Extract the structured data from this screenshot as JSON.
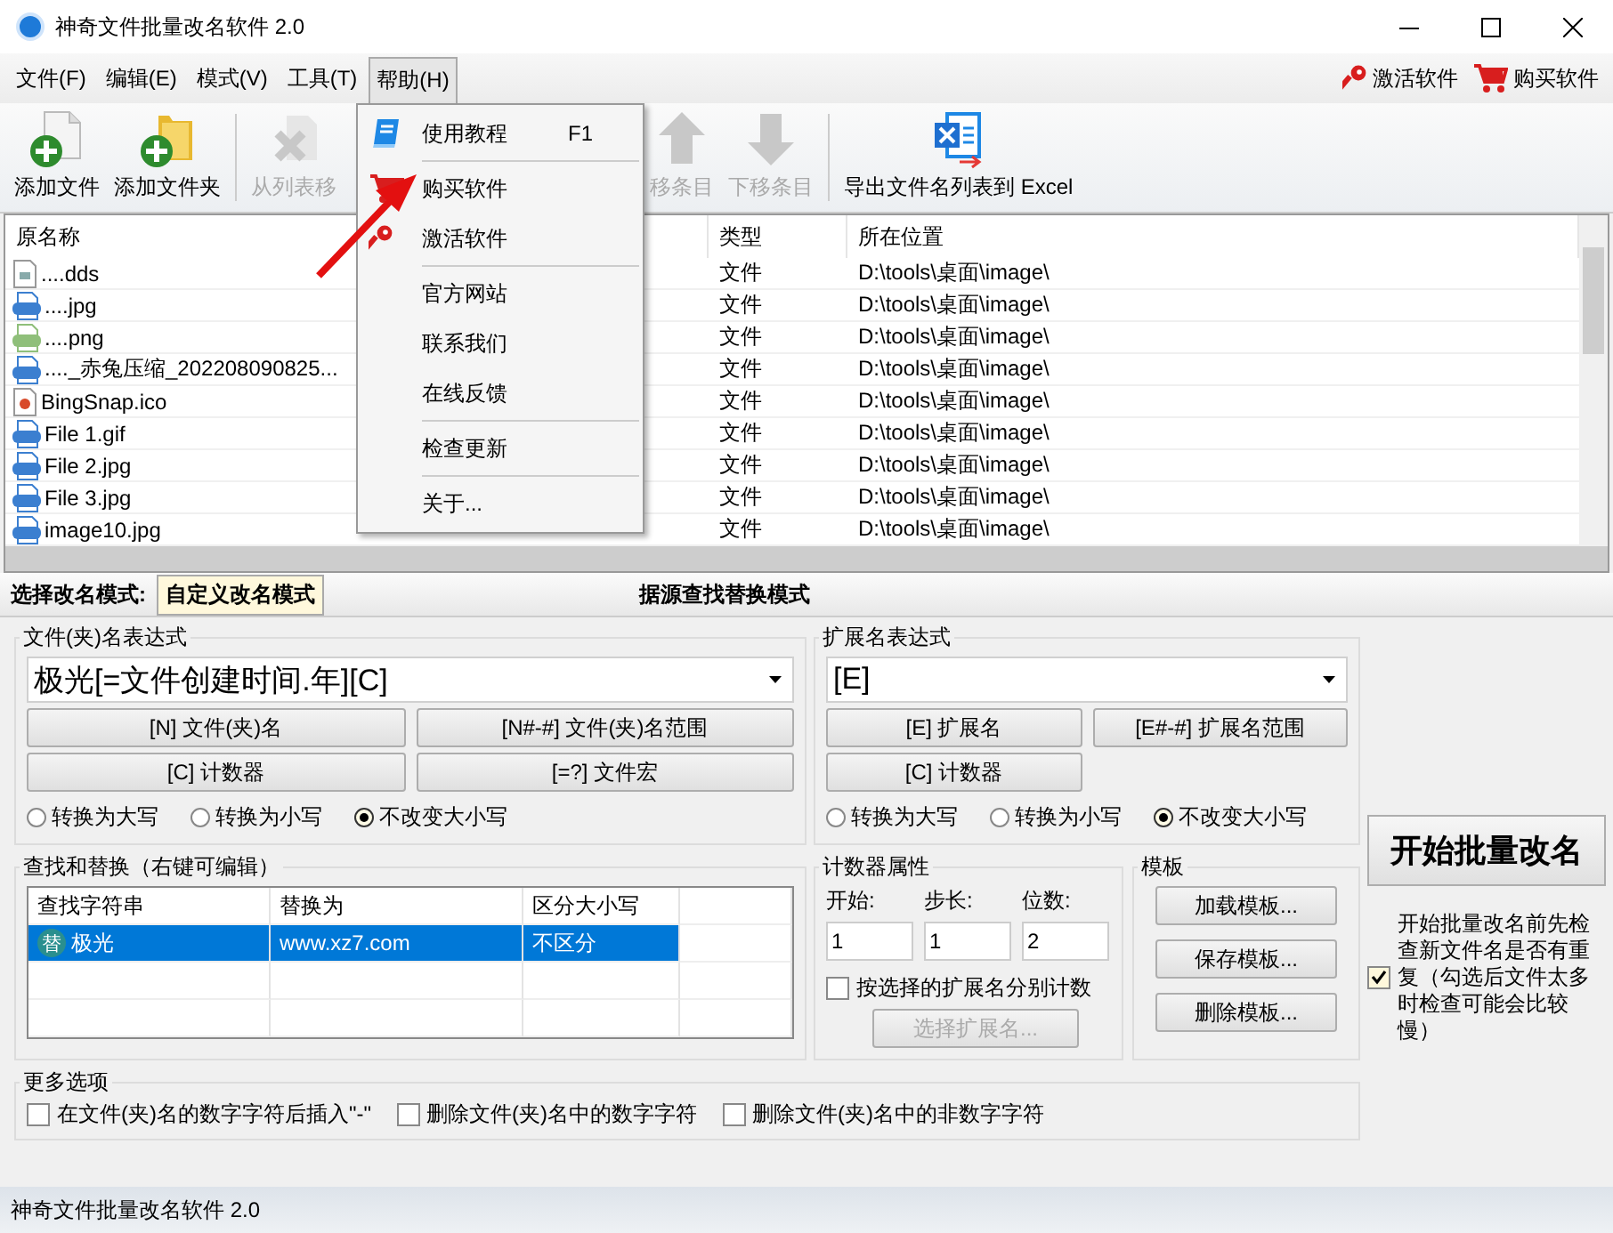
{
  "window": {
    "title": "神奇文件批量改名软件 2.0"
  },
  "menubar": {
    "items": [
      {
        "label": "文件(F)",
        "selected": false
      },
      {
        "label": "编辑(E)",
        "selected": false
      },
      {
        "label": "模式(V)",
        "selected": false
      },
      {
        "label": "工具(T)",
        "selected": false
      },
      {
        "label": "帮助(H)",
        "selected": true
      }
    ],
    "links": [
      {
        "label": "激活软件",
        "kind": "key"
      },
      {
        "label": "购买软件",
        "kind": "cart"
      }
    ]
  },
  "toolbar": [
    {
      "label": "添加文件",
      "kind": "add-file",
      "disabled": false
    },
    {
      "label": "添加文件夹",
      "kind": "add-folder",
      "disabled": false
    },
    {
      "kind": "separator"
    },
    {
      "label": "从列表移",
      "kind": "remove",
      "disabled": true
    },
    {
      "kind": "gap"
    },
    {
      "label": "移条目",
      "kind": "up",
      "disabled": true
    },
    {
      "label": "下移条目",
      "kind": "down",
      "disabled": true
    },
    {
      "kind": "separator"
    },
    {
      "label": "导出文件名列表到 Excel",
      "kind": "excel",
      "disabled": false
    }
  ],
  "help_menu": [
    {
      "kind": "book",
      "label": "使用教程",
      "shortcut": "F1"
    },
    {
      "kind": "separator"
    },
    {
      "kind": "cart",
      "label": "购买软件"
    },
    {
      "kind": "key",
      "label": "激活软件"
    },
    {
      "kind": "separator"
    },
    {
      "kind": "item",
      "label": "官方网站"
    },
    {
      "kind": "item",
      "label": "联系我们"
    },
    {
      "kind": "item",
      "label": "在线反馈"
    },
    {
      "kind": "separator"
    },
    {
      "kind": "item",
      "label": "检查更新"
    },
    {
      "kind": "separator"
    },
    {
      "kind": "item",
      "label": "关于..."
    }
  ],
  "file_list": {
    "columns": [
      "原名称",
      "类型",
      "所在位置"
    ],
    "rows": [
      {
        "kind": "doc",
        "name": "....dds",
        "type": "文件",
        "location": "D:\\tools\\桌面\\image\\"
      },
      {
        "kind": "jpg",
        "name": "....jpg",
        "type": "文件",
        "location": "D:\\tools\\桌面\\image\\"
      },
      {
        "kind": "png",
        "name": "....png",
        "type": "文件",
        "location": "D:\\tools\\桌面\\image\\"
      },
      {
        "kind": "jpg",
        "name": "...._赤兔压缩_202208090825...",
        "type": "文件",
        "location": "D:\\tools\\桌面\\image\\"
      },
      {
        "kind": "ico",
        "name": "BingSnap.ico",
        "type": "文件",
        "location": "D:\\tools\\桌面\\image\\"
      },
      {
        "kind": "gif",
        "name": "File 1.gif",
        "type": "文件",
        "location": "D:\\tools\\桌面\\image\\"
      },
      {
        "kind": "jpg",
        "name": "File 2.jpg",
        "type": "文件",
        "location": "D:\\tools\\桌面\\image\\"
      },
      {
        "kind": "jpg",
        "name": "File 3.jpg",
        "type": "文件",
        "location": "D:\\tools\\桌面\\image\\"
      },
      {
        "kind": "jpg",
        "name": "image10.jpg",
        "type": "文件",
        "location": "D:\\tools\\桌面\\image\\"
      }
    ]
  },
  "mode_bar": {
    "label": "选择改名模式:",
    "tabs": [
      {
        "label": "自定义改名模式",
        "selected": true
      },
      {
        "label": "据源查找替换模式",
        "selected": false
      }
    ]
  },
  "name_expression": {
    "title": "文件(夹)名表达式",
    "value": "极光[=文件创建时间.年][C]",
    "buttons": [
      "[N] 文件(夹)名",
      "[N#-#] 文件(夹)名范围",
      "[C] 计数器",
      "[=?] 文件宏"
    ],
    "case_options": [
      {
        "label": "转换为大写",
        "selected": false
      },
      {
        "label": "转换为小写",
        "selected": false
      },
      {
        "label": "不改变大小写",
        "selected": true
      }
    ]
  },
  "ext_expression": {
    "title": "扩展名表达式",
    "value": "[E]",
    "buttons": [
      "[E] 扩展名",
      "[E#-#] 扩展名范围",
      "[C] 计数器"
    ],
    "case_options": [
      {
        "label": "转换为大写",
        "selected": false
      },
      {
        "label": "转换为小写",
        "selected": false
      },
      {
        "label": "不改变大小写",
        "selected": true
      }
    ]
  },
  "find_replace": {
    "title": "查找和替换（右键可编辑）",
    "columns": [
      "查找字符串",
      "替换为",
      "区分大小写"
    ],
    "rows": [
      {
        "badge": "替",
        "find": "极光",
        "replace": "www.xz7.com",
        "case": "不区分",
        "selected": true
      }
    ]
  },
  "counter": {
    "title": "计数器属性",
    "fields": [
      {
        "label": "开始:",
        "value": "1"
      },
      {
        "label": "步长:",
        "value": "1"
      },
      {
        "label": "位数:",
        "value": "2"
      }
    ],
    "per_extension": {
      "label": "按选择的扩展名分别计数",
      "checked": false
    },
    "select_button": {
      "label": "选择扩展名...",
      "disabled": true
    }
  },
  "templates": {
    "title": "模板",
    "buttons": [
      "加载模板...",
      "保存模板...",
      "删除模板..."
    ]
  },
  "start_button": "开始批量改名",
  "check_duplicates": {
    "label": "开始批量改名前先检查新文件名是否有重复（勾选后文件太多时检查可能会比较慢）",
    "checked": true
  },
  "more_options": {
    "title": "更多选项",
    "options": [
      {
        "label": "在文件(夹)名的数字字符后插入\"-\"",
        "checked": false
      },
      {
        "label": "删除文件(夹)名中的数字字符",
        "checked": false
      },
      {
        "label": "删除文件(夹)名中的非数字字符",
        "checked": false
      }
    ]
  },
  "status_bar": "神奇文件批量改名软件 2.0"
}
